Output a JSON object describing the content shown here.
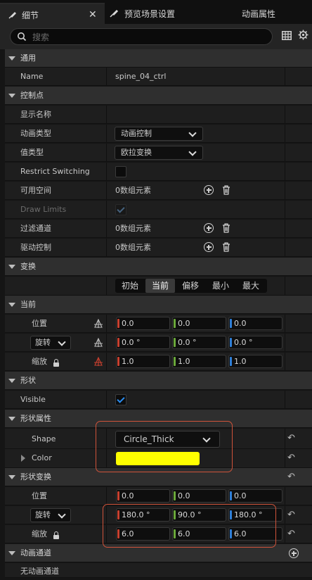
{
  "tabs": [
    {
      "label": "细节"
    },
    {
      "label": "预览场景设置"
    },
    {
      "label": "动画属性"
    }
  ],
  "search": {
    "placeholder": "搜索"
  },
  "general": {
    "category": "通用",
    "name_label": "Name",
    "name_value": "spine_04_ctrl"
  },
  "control_point": {
    "category": "控制点",
    "display_name_label": "显示名称",
    "anim_type_label": "动画类型",
    "anim_type_value": "动画控制",
    "value_type_label": "值类型",
    "value_type_value": "欧拉变换",
    "restrict_switching_label": "Restrict Switching",
    "restrict_switching_checked": false,
    "available_space_label": "可用空间",
    "available_space_value": "0数组元素",
    "draw_limits_label": "Draw Limits",
    "draw_limits_checked": true,
    "filter_channel_label": "过滤通道",
    "filter_channel_value": "0数组元素",
    "driver_control_label": "驱动控制",
    "driver_control_value": "0数组元素"
  },
  "transform": {
    "category": "变换",
    "segments": [
      "初始",
      "当前",
      "偏移",
      "最小",
      "最大"
    ],
    "selected_segment": "当前",
    "current_category": "当前",
    "location_label": "位置",
    "location": [
      "0.0",
      "0.0",
      "0.0"
    ],
    "rotation_label": "旋转",
    "rotation": [
      "0.0 °",
      "0.0 °",
      "0.0 °"
    ],
    "scale_label": "缩放",
    "scale": [
      "1.0",
      "1.0",
      "1.0"
    ]
  },
  "shape": {
    "category": "形状",
    "visible_label": "Visible",
    "visible_checked": true,
    "props_category": "形状属性",
    "shape_label": "Shape",
    "shape_value": "Circle_Thick",
    "color_label": "Color",
    "color_value": "#ffff00",
    "transform_category": "形状变换",
    "location_label": "位置",
    "location": [
      "0.0",
      "0.0",
      "0.0"
    ],
    "rotation_label": "旋转",
    "rotation": [
      "180.0 °",
      "90.0 °",
      "180.0 °"
    ],
    "scale_label": "缩放",
    "scale": [
      "6.0",
      "6.0",
      "6.0"
    ]
  },
  "anim_channel": {
    "category": "动画通道",
    "empty_text": "无动画通道"
  },
  "colors": {
    "x": "#c8402f",
    "y": "#6aa83a",
    "z": "#2f7fd8",
    "highlight": "#d0533a",
    "check": "#2a8df0"
  }
}
